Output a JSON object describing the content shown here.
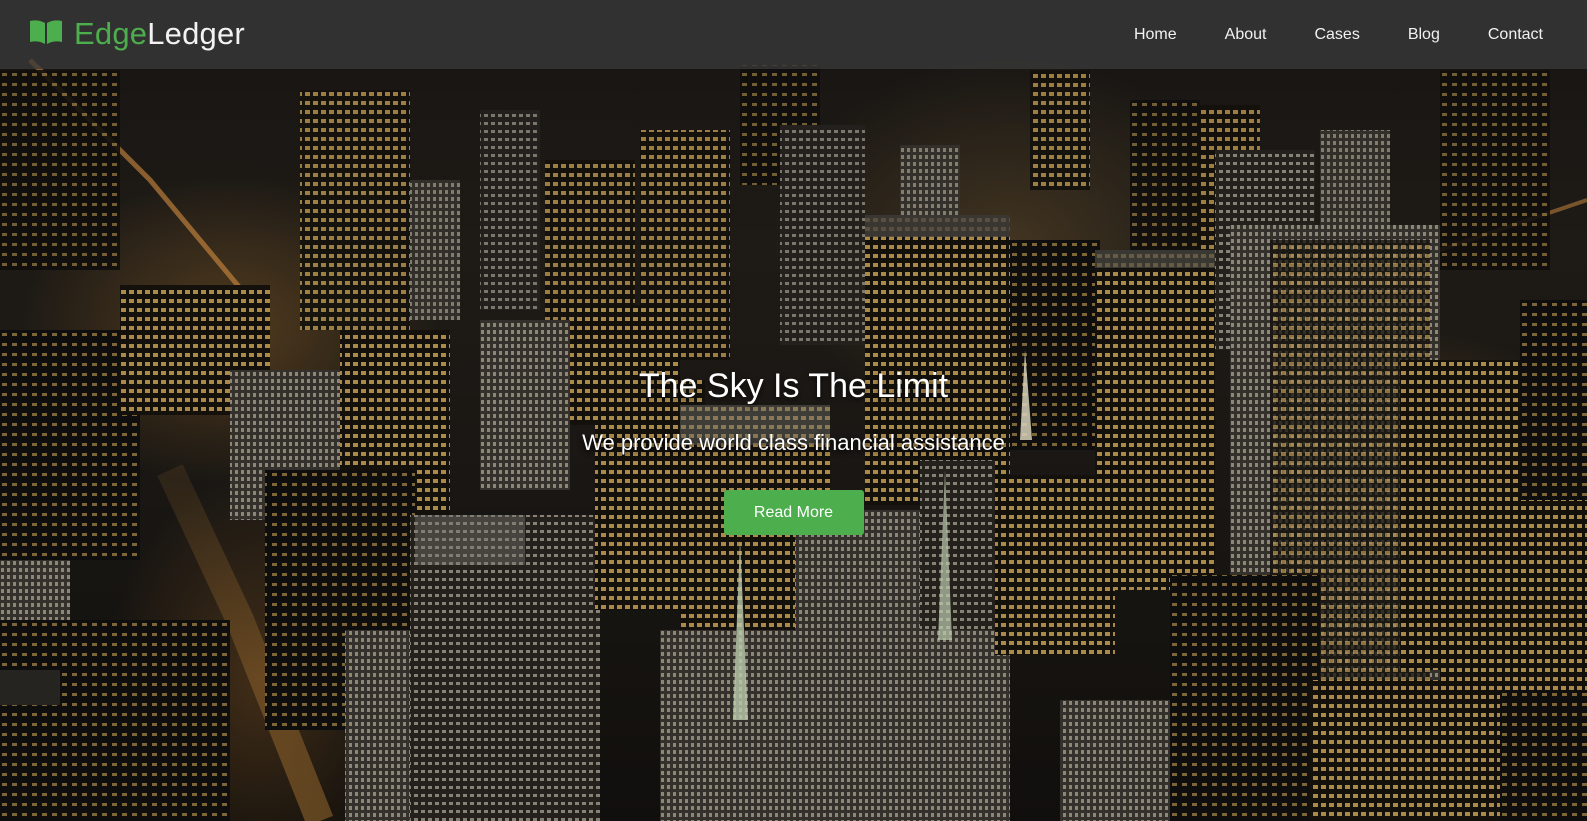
{
  "brand": {
    "name_part1": "Edge",
    "name_part2": "Ledger",
    "icon": "open-book-icon",
    "accent_color": "#4cae4c"
  },
  "nav": {
    "items": [
      {
        "label": "Home"
      },
      {
        "label": "About"
      },
      {
        "label": "Cases"
      },
      {
        "label": "Blog"
      },
      {
        "label": "Contact"
      }
    ]
  },
  "hero": {
    "title": "The Sky Is The Limit",
    "subtitle": "We provide world class financial assistance",
    "button_label": "Read More",
    "button_color": "#4cae4c"
  }
}
